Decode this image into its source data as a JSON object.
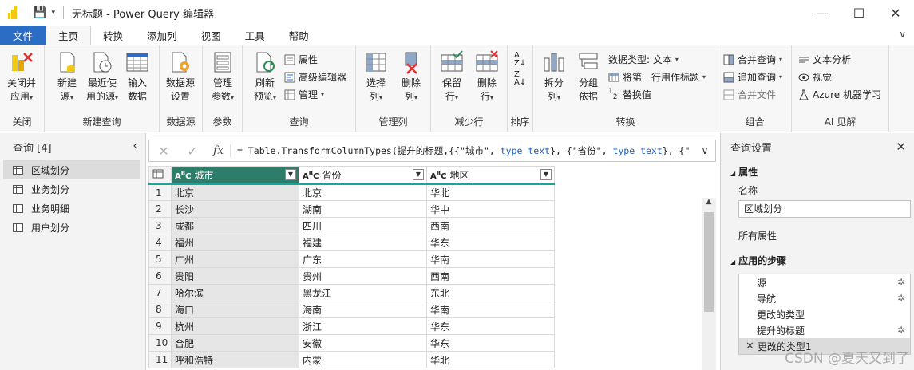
{
  "window": {
    "title": "无标题 - Power Query 编辑器",
    "controls": [
      "—",
      "☐",
      "✕"
    ]
  },
  "tabs": [
    {
      "label": "文件",
      "kind": "file"
    },
    {
      "label": "主页",
      "kind": "active"
    },
    {
      "label": "转换",
      "kind": ""
    },
    {
      "label": "添加列",
      "kind": ""
    },
    {
      "label": "视图",
      "kind": ""
    },
    {
      "label": "工具",
      "kind": ""
    },
    {
      "label": "帮助",
      "kind": ""
    }
  ],
  "ribbon": {
    "close": {
      "label": "关闭",
      "btn1": "关闭并",
      "btn2": "应用"
    },
    "newquery": {
      "label": "新建查询",
      "new1": "新建",
      "new2": "源",
      "recent1": "最近使",
      "recent2": "用的源",
      "enter1": "输入",
      "enter2": "数据"
    },
    "datasource": {
      "label": "数据源",
      "b1": "数据源",
      "b2": "设置"
    },
    "params": {
      "label": "参数",
      "b1": "管理",
      "b2": "参数"
    },
    "query": {
      "label": "查询",
      "refresh1": "刷新",
      "refresh2": "预览",
      "props": "属性",
      "adv": "高级编辑器",
      "manage": "管理"
    },
    "managecols": {
      "label": "管理列",
      "choose1": "选择",
      "choose2": "列",
      "remove1": "删除",
      "remove2": "列"
    },
    "reducerows": {
      "label": "减少行",
      "keep1": "保留",
      "keep2": "行",
      "remove1": "删除",
      "remove2": "行"
    },
    "sort": {
      "label": "排序"
    },
    "transform": {
      "label": "转换",
      "split1": "拆分",
      "split2": "列",
      "group1": "分组",
      "group2": "依据",
      "dtype": "数据类型: 文本",
      "header": "将第一行用作标题",
      "replace": "替换值"
    },
    "combine": {
      "label": "组合",
      "merge": "合并查询",
      "append": "追加查询",
      "files": "合并文件"
    },
    "ai": {
      "label": "AI 见解",
      "text": "文本分析",
      "vision": "视觉",
      "azure": "Azure 机器学习"
    }
  },
  "queries_pane": {
    "title": "查询 [4]",
    "items": [
      "区域划分",
      "业务划分",
      "业务明细",
      "用户划分"
    ],
    "selected_index": 0
  },
  "formula_bar": {
    "prefix": "= Table.TransformColumnTypes(提升的标题,{{\"城市\", ",
    "kw1": "type text",
    "mid": "}, {\"省份\", ",
    "kw2": "type text",
    "suffix": "}, {\""
  },
  "table": {
    "columns": [
      "城市",
      "省份",
      "地区"
    ],
    "rows": [
      [
        "1",
        "北京",
        "北京",
        "华北"
      ],
      [
        "2",
        "长沙",
        "湖南",
        "华中"
      ],
      [
        "3",
        "成都",
        "四川",
        "西南"
      ],
      [
        "4",
        "福州",
        "福建",
        "华东"
      ],
      [
        "5",
        "广州",
        "广东",
        "华南"
      ],
      [
        "6",
        "贵阳",
        "贵州",
        "西南"
      ],
      [
        "7",
        "哈尔滨",
        "黑龙江",
        "东北"
      ],
      [
        "8",
        "海口",
        "海南",
        "华南"
      ],
      [
        "9",
        "杭州",
        "浙江",
        "华东"
      ],
      [
        "10",
        "合肥",
        "安徽",
        "华东"
      ],
      [
        "11",
        "呼和浩特",
        "内蒙",
        "华北"
      ]
    ]
  },
  "settings_pane": {
    "title": "查询设置",
    "props_section": "属性",
    "name_label": "名称",
    "name_value": "区域划分",
    "all_props": "所有属性",
    "steps_section": "应用的步骤",
    "steps": [
      "源",
      "导航",
      "更改的类型",
      "提升的标题",
      "更改的类型1"
    ],
    "selected_step": 4
  },
  "watermark": "CSDN @夏天又到了"
}
